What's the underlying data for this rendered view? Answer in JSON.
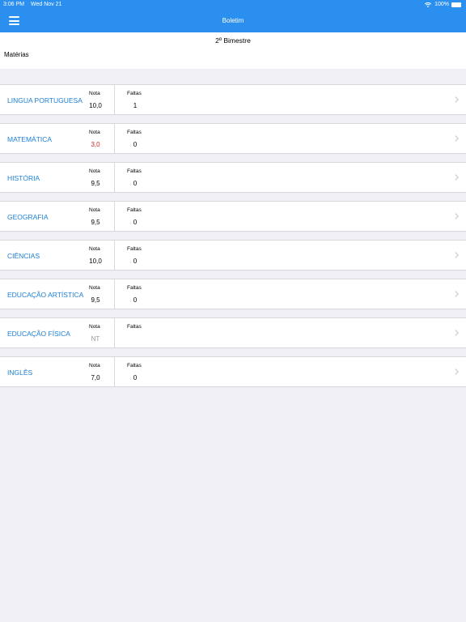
{
  "status_bar": {
    "time": "3:06 PM",
    "date": "Wed Nov 21",
    "battery": "100%"
  },
  "nav": {
    "title": "Boletim",
    "menu_icon": "hamburger-menu-icon"
  },
  "header": {
    "period": "2º Bimestre",
    "section_label": "Matérias"
  },
  "colors": {
    "brand": "#2b8ff0",
    "subject_text": "#1c7fd6",
    "low_grade": "#e0201b",
    "no_grade": "#9a9a9a",
    "background": "#efeff4"
  },
  "subjects": [
    {
      "name": "LINGUA PORTUGUESA",
      "nota_label": "Nota",
      "nota": "10,0",
      "faltas_label": "Faltas",
      "faltas": "1"
    },
    {
      "name": "MATEMÁTICA",
      "nota_label": "Nota",
      "nota": "3,0",
      "faltas_label": "Faltas",
      "faltas": "0"
    },
    {
      "name": "HISTÓRIA",
      "nota_label": "Nota",
      "nota": "9,5",
      "faltas_label": "Faltas",
      "faltas": "0"
    },
    {
      "name": "GEOGRAFIA",
      "nota_label": "Nota",
      "nota": "9,5",
      "faltas_label": "Faltas",
      "faltas": "0"
    },
    {
      "name": "CIÊNCIAS",
      "nota_label": "Nota",
      "nota": "10,0",
      "faltas_label": "Faltas",
      "faltas": "0"
    },
    {
      "name": "EDUCAÇÃO ARTÍSTICA",
      "nota_label": "Nota",
      "nota": "9,5",
      "faltas_label": "Faltas",
      "faltas": "0"
    },
    {
      "name": "EDUCAÇÃO FÍSICA",
      "nota_label": "Nota",
      "nota": "NT",
      "faltas_label": "Faltas",
      "faltas": ""
    },
    {
      "name": "INGLÊS",
      "nota_label": "Nota",
      "nota": "7,0",
      "faltas_label": "Faltas",
      "faltas": "0"
    }
  ]
}
